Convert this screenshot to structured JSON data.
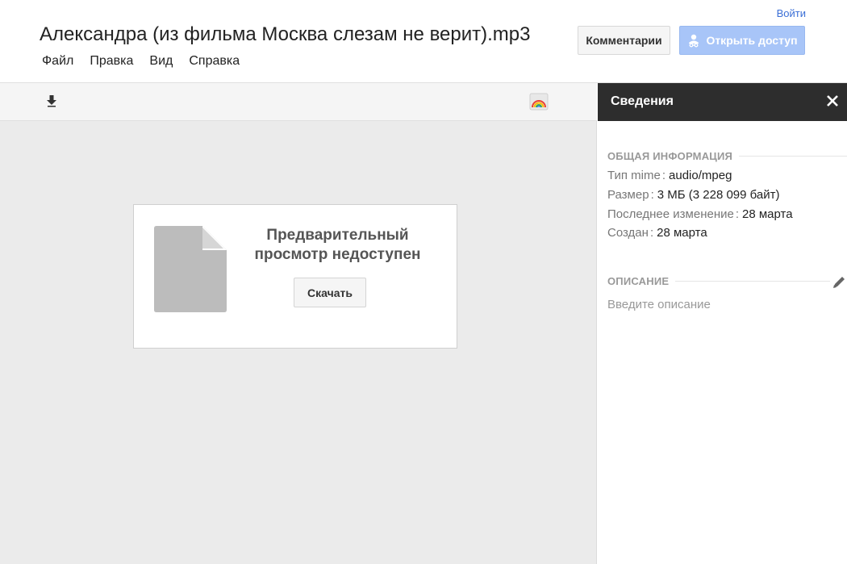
{
  "header": {
    "title": "Александра (из фильма Москва слезам не верит).mp3",
    "signin": "Войти",
    "menu": [
      "Файл",
      "Правка",
      "Вид",
      "Справка"
    ],
    "comments_button": "Комментарии",
    "share_button": "Открыть доступ"
  },
  "viewer": {
    "toolbar": {
      "download_icon": "download-arrow-icon",
      "drive_icon": "google-drive-icon"
    },
    "preview_message": "Предварительный просмотр недоступен",
    "download_button": "Скачать",
    "file_icon": "generic-file-icon"
  },
  "details": {
    "title": "Сведения",
    "general_heading": "ОБЩАЯ ИНФОРМАЦИЯ",
    "fields": [
      {
        "label": "Тип mime",
        "value": "audio/mpeg"
      },
      {
        "label": "Размер",
        "value": "3 МБ (3 228 099 байт)"
      },
      {
        "label": "Последнее изменение",
        "value": "28 марта"
      },
      {
        "label": "Создан",
        "value": "28 марта"
      }
    ],
    "description_heading": "ОПИСАНИЕ",
    "description_placeholder": "Введите описание"
  },
  "colors": {
    "link": "#3b6fd6",
    "share_button_bg": "#a8c5f8",
    "panel_header_bg": "#2d2d2d",
    "viewer_bg": "#ebebeb"
  }
}
